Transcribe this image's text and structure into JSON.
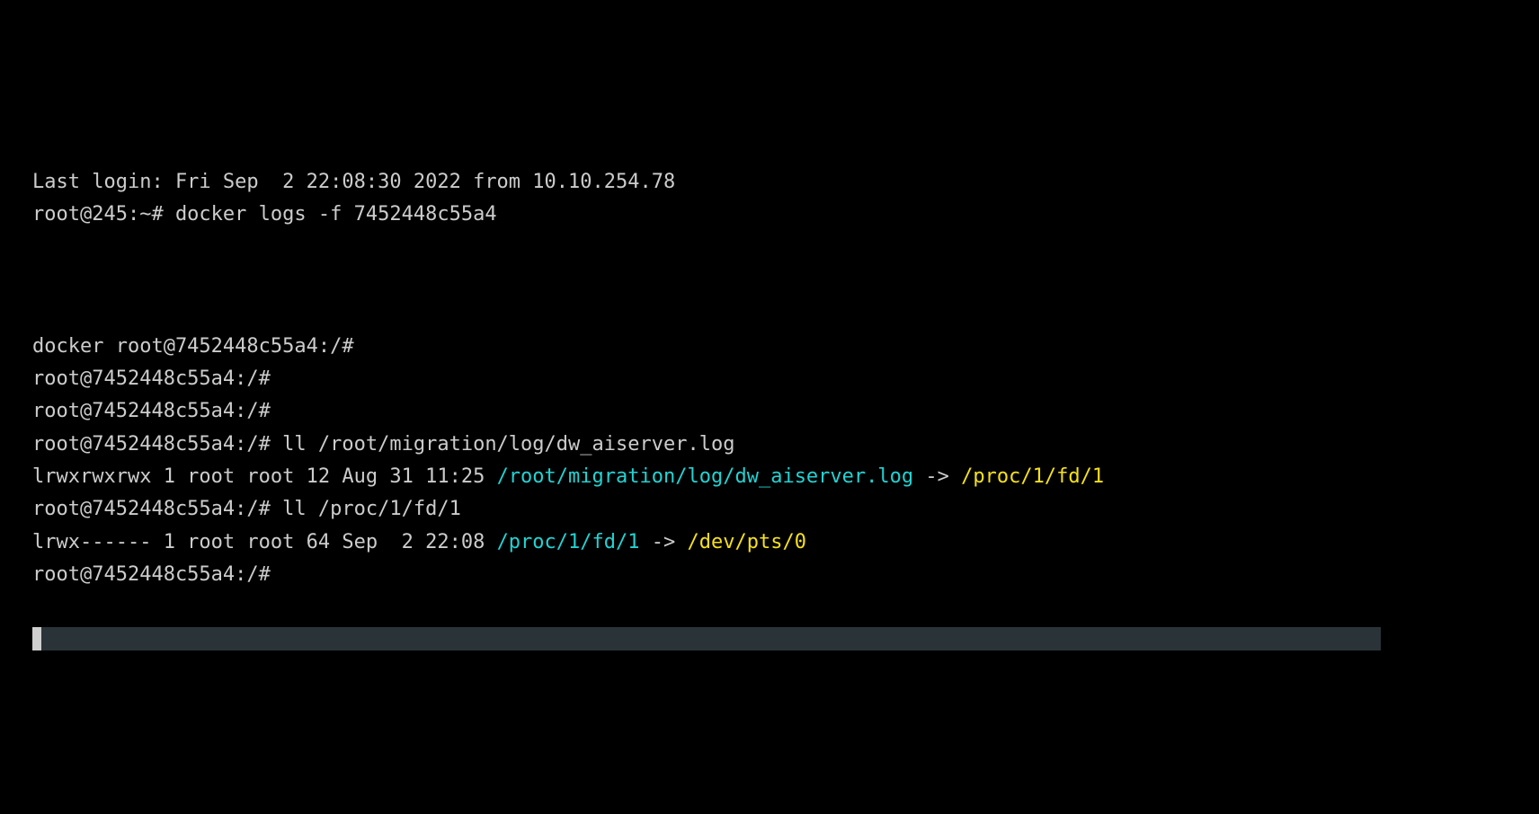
{
  "lines": {
    "l1": "Last login: Fri Sep  2 22:08:30 2022 from 10.10.254.78",
    "l2": "root@245:~# docker logs -f 7452448c55a4",
    "l3": "docker root@7452448c55a4:/#",
    "l4": "root@7452448c55a4:/#",
    "l5": "root@7452448c55a4:/#",
    "l6": "root@7452448c55a4:/# ll /root/migration/log/dw_aiserver.log",
    "l7a": "lrwxrwxrwx 1 root root 12 Aug 31 11:25 ",
    "l7b": "/root/migration/log/dw_aiserver.log",
    "l7c": " -> ",
    "l7d": "/proc/1/fd/1",
    "l8": "root@7452448c55a4:/# ll /proc/1/fd/1",
    "l9a": "lrwx------ 1 root root 64 Sep  2 22:08 ",
    "l9b": "/proc/1/fd/1",
    "l9c": " -> ",
    "l9d": "/dev/pts/0",
    "l10": "root@7452448c55a4:/#"
  }
}
